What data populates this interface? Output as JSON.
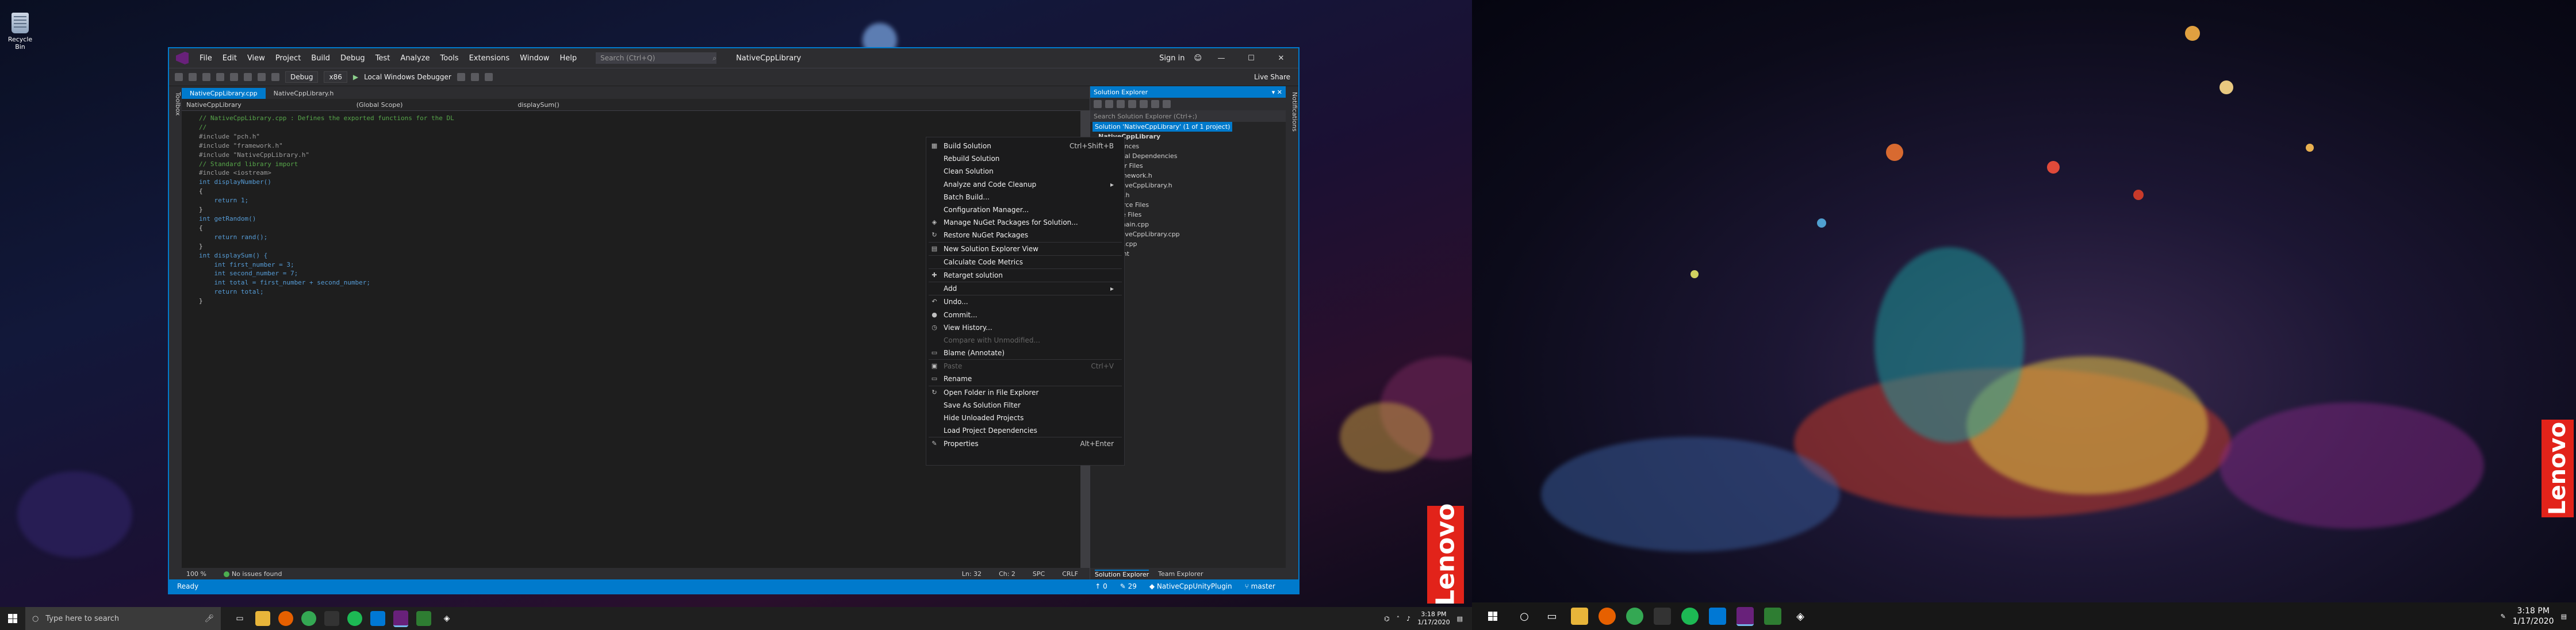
{
  "desktop": {
    "recycle_bin_label": "Recycle Bin"
  },
  "vs": {
    "menu": [
      "File",
      "Edit",
      "View",
      "Project",
      "Build",
      "Debug",
      "Test",
      "Analyze",
      "Tools",
      "Extensions",
      "Window",
      "Help"
    ],
    "search_placeholder": "Search (Ctrl+Q)",
    "window_title": "NativeCppLibrary",
    "sign_in": "Sign in",
    "toolbar": {
      "config": "Debug",
      "platform": "x86",
      "debugger": "Local Windows Debugger",
      "live_share": "Live Share"
    },
    "left_tabs": "Toolbox",
    "right_tabs": "Notifications",
    "doc_tabs": [
      "NativeCppLibrary.cpp",
      "NativeCppLibrary.h"
    ],
    "nav": {
      "project": "NativeCppLibrary",
      "scope": "(Global Scope)",
      "member": "displaySum()"
    },
    "code_lines": [
      "// NativeCppLibrary.cpp : Defines the exported functions for the DL",
      "//",
      "",
      "",
      "#include \"pch.h\"",
      "#include \"framework.h\"",
      "#include \"NativeCppLibrary.h\"",
      "",
      "",
      "// Standard library import",
      "#include <iostream>",
      "",
      "",
      "int displayNumber()",
      "{",
      "    return 1;",
      "}",
      "",
      "int getRandom()",
      "{",
      "    return rand();",
      "}",
      "",
      "",
      "int displaySum() {",
      "    int first_number = 3;",
      "    int second_number = 7;",
      "",
      "    int total = first_number + second_number;",
      "",
      "    return total;",
      "}"
    ],
    "editor_status": {
      "zoom": "100 %",
      "issues": "No issues found",
      "ln": "Ln: 32",
      "ch": "Ch: 2",
      "spc": "SPC",
      "crlf": "CRLF"
    },
    "solution_explorer": {
      "title": "Solution Explorer",
      "search_placeholder": "Search Solution Explorer (Ctrl+;)",
      "solution_label": "Solution 'NativeCppLibrary' (1 of 1 project)",
      "tree": [
        "NativeCppLibrary",
        "References",
        "External Dependencies",
        "Header Files",
        "framework.h",
        "NativeCppLibrary.h",
        "pch.h",
        "Resource Files",
        "Source Files",
        "dllmain.cpp",
        "NativeCppLibrary.cpp",
        "pch.cpp",
        "sdk.hint"
      ],
      "tabs": [
        "Solution Explorer",
        "Team Explorer"
      ]
    },
    "status": {
      "ready": "Ready",
      "up": "0",
      "pen": "29",
      "repo": "NativeCppUnityPlugin",
      "branch": "master"
    }
  },
  "context_menu": [
    {
      "label": "Build Solution",
      "shortcut": "Ctrl+Shift+B",
      "icon": "build-icon",
      "enabled": true
    },
    {
      "label": "Rebuild Solution",
      "shortcut": "",
      "icon": "",
      "enabled": true
    },
    {
      "label": "Clean Solution",
      "shortcut": "",
      "icon": "",
      "enabled": true
    },
    {
      "label": "Analyze and Code Cleanup",
      "shortcut": "",
      "icon": "",
      "enabled": true,
      "submenu": true
    },
    {
      "label": "Batch Build...",
      "shortcut": "",
      "icon": "",
      "enabled": true
    },
    {
      "label": "Configuration Manager...",
      "shortcut": "",
      "icon": "",
      "enabled": true
    },
    {
      "label": "Manage NuGet Packages for Solution...",
      "shortcut": "",
      "icon": "nuget-icon",
      "enabled": true
    },
    {
      "label": "Restore NuGet Packages",
      "shortcut": "",
      "icon": "restore-icon",
      "enabled": true
    },
    {
      "sep": true
    },
    {
      "label": "New Solution Explorer View",
      "shortcut": "",
      "icon": "explorer-view-icon",
      "enabled": true
    },
    {
      "sep": true
    },
    {
      "label": "Calculate Code Metrics",
      "shortcut": "",
      "icon": "",
      "enabled": true
    },
    {
      "sep": true
    },
    {
      "label": "Retarget solution",
      "shortcut": "",
      "icon": "retarget-icon",
      "enabled": true
    },
    {
      "sep": true
    },
    {
      "label": "Add",
      "shortcut": "",
      "icon": "",
      "enabled": true,
      "submenu": true
    },
    {
      "sep": true
    },
    {
      "label": "Undo...",
      "shortcut": "",
      "icon": "undo-icon",
      "enabled": true
    },
    {
      "label": "Commit...",
      "shortcut": "",
      "icon": "commit-icon",
      "enabled": true
    },
    {
      "label": "View History...",
      "shortcut": "",
      "icon": "history-icon",
      "enabled": true
    },
    {
      "label": "Compare with Unmodified...",
      "shortcut": "",
      "icon": "",
      "enabled": false
    },
    {
      "label": "Blame (Annotate)",
      "shortcut": "",
      "icon": "blame-icon",
      "enabled": true
    },
    {
      "sep": true
    },
    {
      "label": "Paste",
      "shortcut": "Ctrl+V",
      "icon": "paste-icon",
      "enabled": false
    },
    {
      "label": "Rename",
      "shortcut": "",
      "icon": "rename-icon",
      "enabled": true
    },
    {
      "sep": true
    },
    {
      "label": "Open Folder in File Explorer",
      "shortcut": "",
      "icon": "folder-icon",
      "enabled": true
    },
    {
      "label": "Save As Solution Filter",
      "shortcut": "",
      "icon": "",
      "enabled": true
    },
    {
      "label": "Hide Unloaded Projects",
      "shortcut": "",
      "icon": "",
      "enabled": true
    },
    {
      "label": "Load Project Dependencies",
      "shortcut": "",
      "icon": "",
      "enabled": true
    },
    {
      "sep": true
    },
    {
      "label": "Properties",
      "shortcut": "Alt+Enter",
      "icon": "wrench-icon",
      "enabled": true
    }
  ],
  "taskbar1": {
    "search_placeholder": "Type here to search",
    "time": "3:18 PM",
    "date": "1/17/2020"
  },
  "taskbar2": {
    "time": "3:18 PM",
    "date": "1/17/2020"
  },
  "brand": {
    "name": "Lenovo",
    "color": "#e2231a",
    "accent": "#007acc"
  }
}
